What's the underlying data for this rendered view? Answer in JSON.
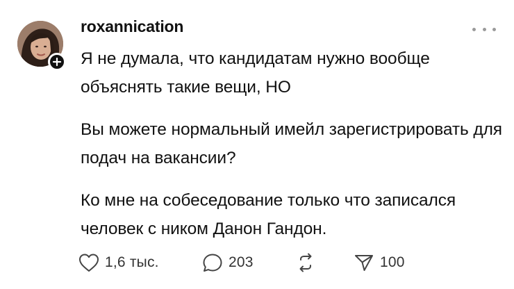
{
  "post": {
    "username": "roxannication",
    "paragraphs": [
      "Я не думала, что кандидатам нужно вообще объяснять такие вещи, НО",
      "Вы можете нормальный имейл зарегистрировать для подач на вакансии?",
      "Ко мне на собеседование только что записался человек с ником Данон Гандон."
    ],
    "icons": {
      "avatar": "avatar-photo",
      "follow": "plus-icon",
      "more": "more-dots-icon"
    }
  },
  "actions": {
    "likes": "1,6 тыс.",
    "replies": "203",
    "shares": "100",
    "icons": [
      "heart-icon",
      "comment-icon",
      "repost-icon",
      "share-icon"
    ]
  },
  "colors": {
    "text": "#111111",
    "muted": "#9a9a9a",
    "badge": "#111111",
    "background": "#ffffff"
  }
}
